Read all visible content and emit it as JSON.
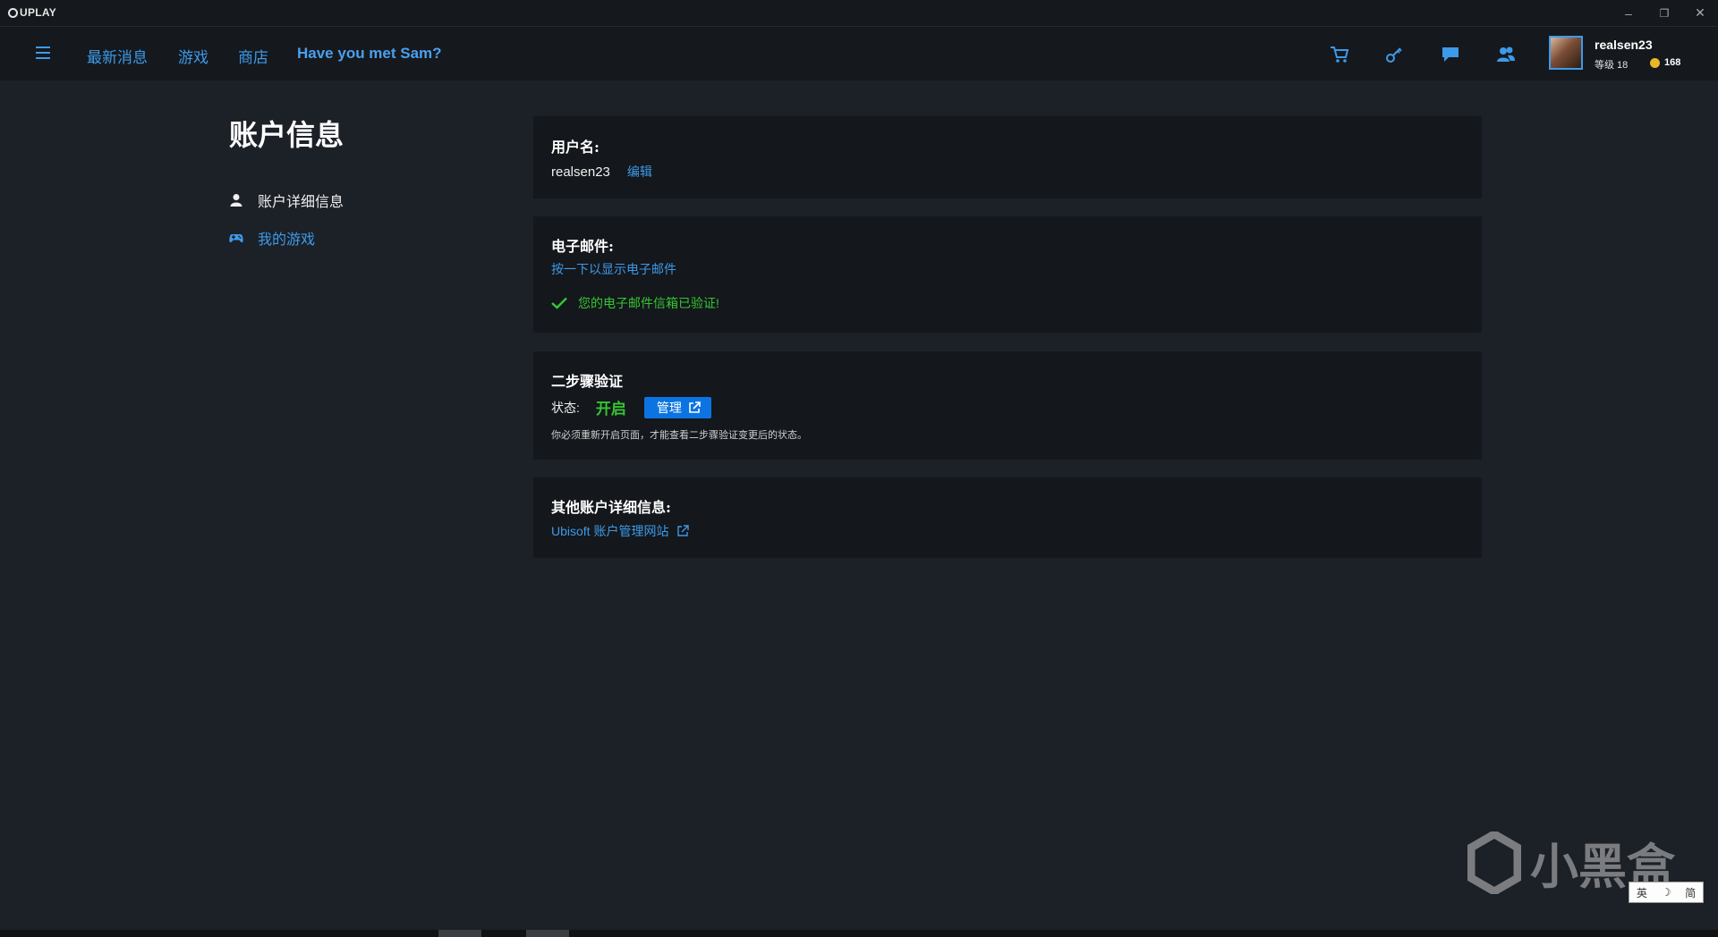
{
  "window": {
    "app_name": "UPLAY",
    "minimize": "–",
    "restore": "❐",
    "close": "✕"
  },
  "nav": {
    "links": [
      "最新消息",
      "游戏",
      "商店",
      "Have you met Sam?"
    ],
    "icons": [
      "cart-icon",
      "key-icon",
      "chat-icon",
      "friends-icon"
    ]
  },
  "user": {
    "name": "realsen23",
    "level": "等级 18",
    "coins": "168"
  },
  "sidebar": {
    "title": "账户信息",
    "items": [
      {
        "label": "账户详细信息",
        "icon": "user-icon"
      },
      {
        "label": "我的游戏",
        "icon": "gamepad-icon"
      }
    ]
  },
  "username_card": {
    "title": "用户名:",
    "value": "realsen23",
    "edit": "编辑"
  },
  "email_card": {
    "title": "电子邮件:",
    "reveal": "按一下以显示电子邮件",
    "verified": "您的电子邮件信箱已验证!"
  },
  "twofa_card": {
    "title": "二步骤验证",
    "status_label": "状态:",
    "status_value": "开启",
    "manage": "管理",
    "note": "你必须重新开启页面，才能查看二步骤验证变更后的状态。"
  },
  "other_card": {
    "title": "其他账户详细信息:",
    "link": "Ubisoft 账户管理网站"
  },
  "watermark": "小黑盒",
  "ime": [
    "英",
    "☽",
    "简"
  ],
  "colors": {
    "accent": "#3d9ae8",
    "success": "#35c531",
    "button": "#0b74e2",
    "background": "#1c2027",
    "card": "#14171c"
  }
}
